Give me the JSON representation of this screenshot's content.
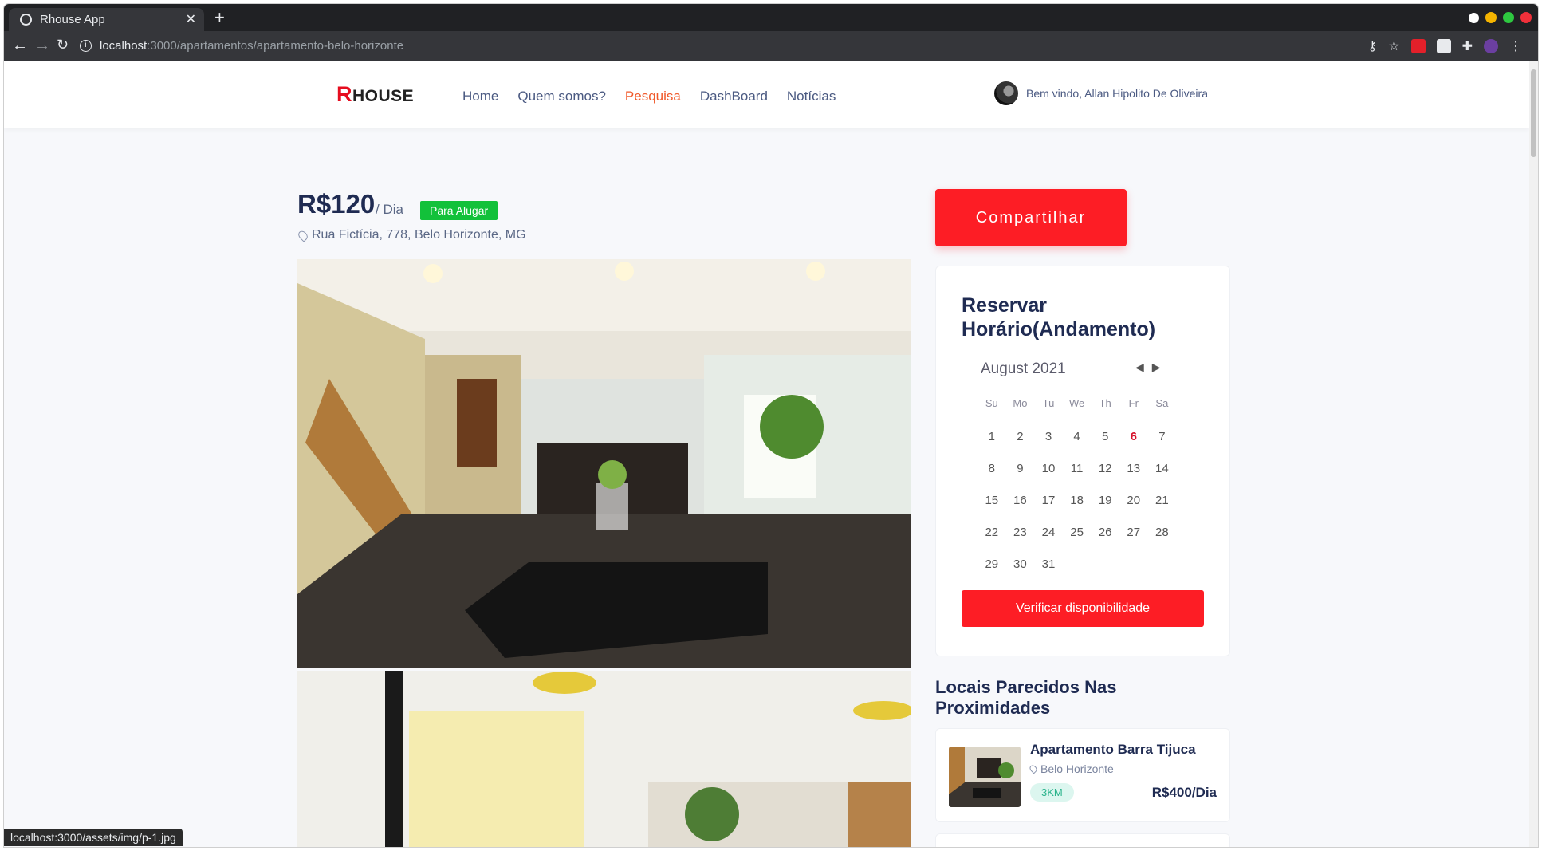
{
  "browser": {
    "tab_title": "Rhouse App",
    "url_host": "localhost",
    "url_path": ":3000/apartamentos/apartamento-belo-horizonte",
    "status_url": "localhost:3000/assets/img/p-1.jpg"
  },
  "header": {
    "logo_r": "R",
    "logo_rest": "HOUSE",
    "menu": [
      {
        "label": "Home"
      },
      {
        "label": "Quem somos?"
      },
      {
        "label": "Pesquisa"
      },
      {
        "label": "DashBoard"
      },
      {
        "label": "Notícias"
      }
    ],
    "user_greeting": "Bem vindo, Allan Hipolito De Oliveira"
  },
  "listing": {
    "price": "R$120",
    "per": "/ Dia",
    "badge": "Para Alugar",
    "address": "Rua Fictícia, 778, Belo Horizonte, MG"
  },
  "sidebar": {
    "share_label": "Compartilhar",
    "booking_title": "Reservar Horário(Andamento)",
    "calendar": {
      "month_label": "August 2021",
      "weekdays": [
        "Su",
        "Mo",
        "Tu",
        "We",
        "Th",
        "Fr",
        "Sa"
      ],
      "days": [
        "1",
        "2",
        "3",
        "4",
        "5",
        "6",
        "7",
        "8",
        "9",
        "10",
        "11",
        "12",
        "13",
        "14",
        "15",
        "16",
        "17",
        "18",
        "19",
        "20",
        "21",
        "22",
        "23",
        "24",
        "25",
        "26",
        "27",
        "28",
        "29",
        "30",
        "31"
      ],
      "today": "6"
    },
    "check_label": "Verificar disponibilidade",
    "similar_title": "Locais Parecidos Nas Proximidades",
    "similar": [
      {
        "name": "Apartamento Barra Tijuca",
        "city": "Belo Horizonte",
        "distance": "3KM",
        "price": "R$400/Dia"
      }
    ]
  },
  "colors": {
    "accent_red": "#fd1d25",
    "active_menu": "#f0592a",
    "badge_green": "#12c13a",
    "heading_navy": "#1f2b52"
  }
}
